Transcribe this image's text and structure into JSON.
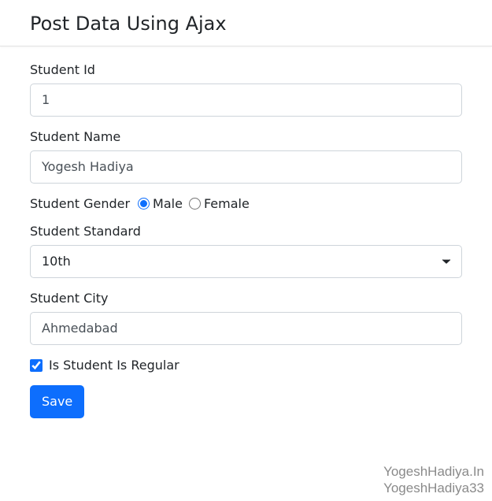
{
  "header": {
    "title": "Post Data Using Ajax"
  },
  "form": {
    "studentId": {
      "label": "Student Id",
      "value": "1"
    },
    "studentName": {
      "label": "Student Name",
      "value": "Yogesh Hadiya"
    },
    "gender": {
      "label": "Student Gender",
      "options": {
        "male": "Male",
        "female": "Female"
      },
      "selected": "male"
    },
    "standard": {
      "label": "Student Standard",
      "value": "10th"
    },
    "city": {
      "label": "Student City",
      "value": "Ahmedabad"
    },
    "regular": {
      "label": "Is Student Is Regular",
      "checked": true
    },
    "saveButton": "Save"
  },
  "watermark": {
    "line1": "YogeshHadiya.In",
    "line2": "YogeshHadiya33"
  }
}
